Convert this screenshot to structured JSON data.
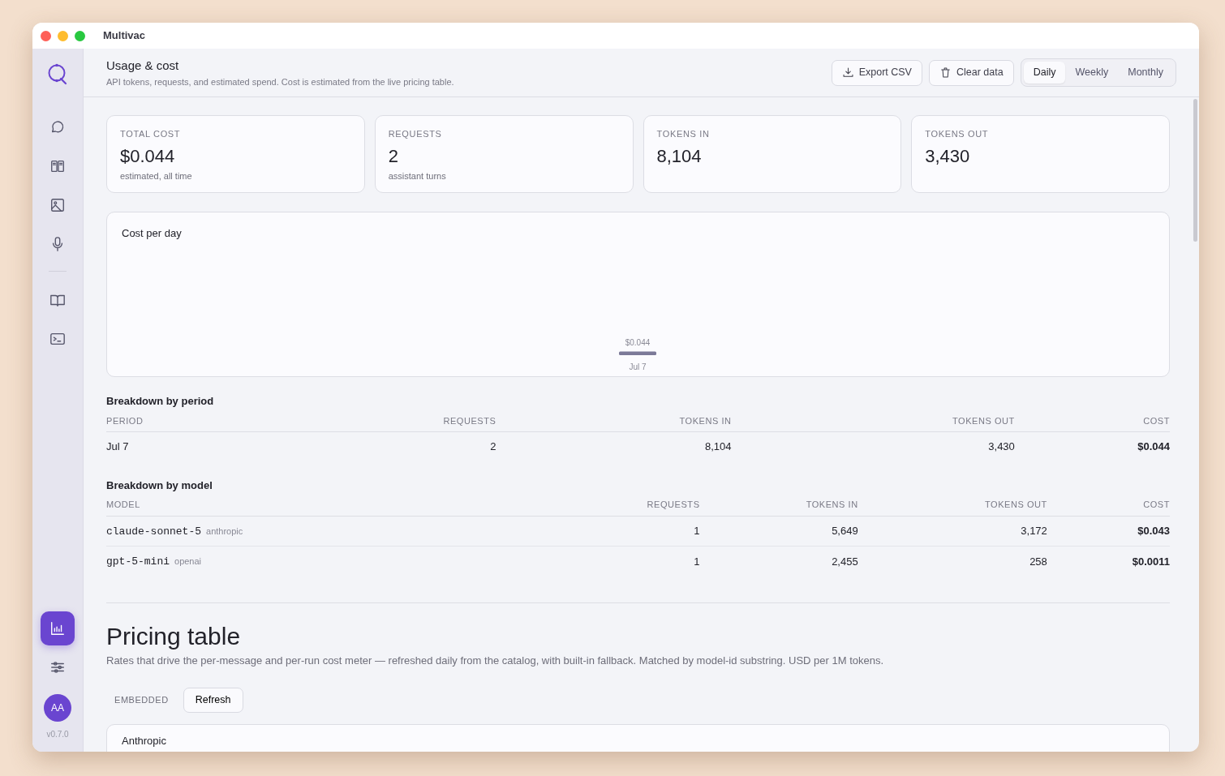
{
  "window": {
    "title": "Multivac"
  },
  "sidebar": {
    "items": [
      {
        "kind": "chat",
        "selected": false
      },
      {
        "kind": "panels",
        "selected": false
      },
      {
        "kind": "image",
        "selected": false
      },
      {
        "kind": "mic",
        "selected": false
      },
      {
        "kind": "book",
        "selected": false
      },
      {
        "kind": "terminal",
        "selected": false
      }
    ],
    "bottom_items": [
      {
        "kind": "chart",
        "selected": true
      },
      {
        "kind": "sliders",
        "selected": false
      }
    ],
    "avatar": "AA",
    "version": "v0.7.0"
  },
  "header": {
    "title": "Usage & cost",
    "subtitle": "API tokens, requests, and estimated spend. Cost is estimated from the live pricing table.",
    "buttons": [
      {
        "label": "Export CSV",
        "kind": "download"
      },
      {
        "label": "Clear data",
        "kind": "trash"
      }
    ],
    "periods": [
      {
        "label": "Daily",
        "selected": true
      },
      {
        "label": "Weekly",
        "selected": false
      },
      {
        "label": "Monthly",
        "selected": false
      }
    ]
  },
  "stats": [
    {
      "label": "TOTAL COST",
      "value": "$0.044",
      "note": "estimated, all time"
    },
    {
      "label": "REQUESTS",
      "value": "2",
      "note": "assistant turns"
    },
    {
      "label": "TOKENS IN",
      "value": "8,104"
    },
    {
      "label": "TOKENS OUT",
      "value": "3,430"
    }
  ],
  "cost_chart": {
    "title": "Cost per day",
    "chart_data": {
      "type": "bar",
      "categories": [
        "Jul 7"
      ],
      "values": [
        0.044
      ],
      "value_labels": [
        "$0.044"
      ]
    }
  },
  "period_table": {
    "title": "Breakdown by period",
    "columns": [
      "PERIOD",
      "REQUESTS",
      "TOKENS IN",
      "TOKENS OUT",
      "COST"
    ],
    "rows": [
      {
        "period": "Jul 7",
        "requests": "2",
        "tokens_in": "8,104",
        "tokens_out": "3,430",
        "cost": "$0.044"
      }
    ]
  },
  "model_table": {
    "title": "Breakdown by model",
    "columns": [
      "MODEL",
      "REQUESTS",
      "TOKENS IN",
      "TOKENS OUT",
      "COST"
    ],
    "rows": [
      {
        "model": "claude-sonnet-5",
        "provider": "anthropic",
        "requests": "1",
        "tokens_in": "5,649",
        "tokens_out": "3,172",
        "cost": "$0.043"
      },
      {
        "model": "gpt-5-mini",
        "provider": "openai",
        "requests": "1",
        "tokens_in": "2,455",
        "tokens_out": "258",
        "cost": "$0.0011"
      }
    ]
  },
  "pricing": {
    "title": "Pricing table",
    "description": "Rates that drive the per-message and per-run cost meter — refreshed daily from the catalog, with built-in fallback. Matched by model-id substring. USD per 1M tokens.",
    "source": "EMBEDDED",
    "refresh_button": "Refresh",
    "sections": [
      {
        "title": "Anthropic"
      }
    ]
  }
}
